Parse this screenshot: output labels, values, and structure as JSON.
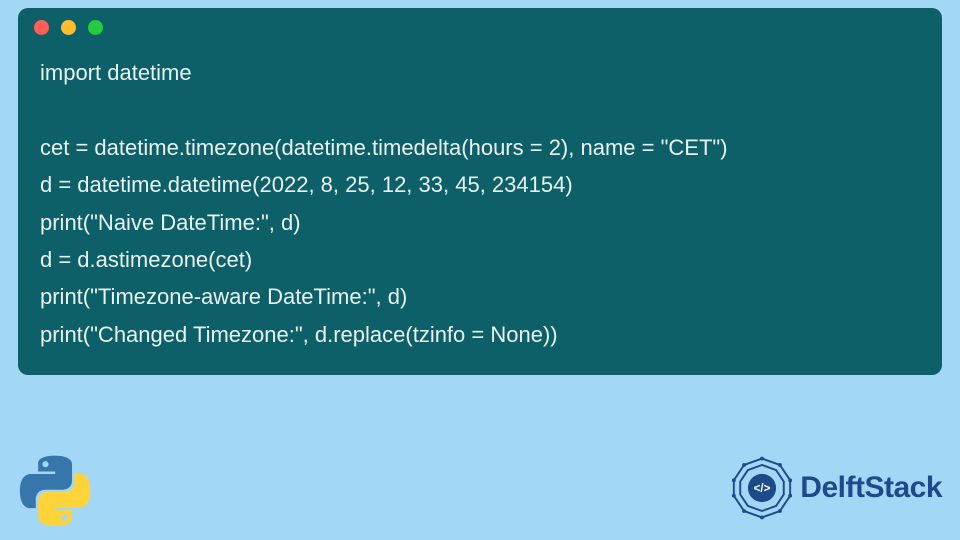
{
  "card": {
    "dots": {
      "red": "#ff5f56",
      "yellow": "#ffbd2e",
      "green": "#27c93f"
    },
    "bg": "#0d6067"
  },
  "code": {
    "lines": [
      "import datetime",
      "",
      "cet = datetime.timezone(datetime.timedelta(hours = 2), name = \"CET\")",
      "d = datetime.datetime(2022, 8, 25, 12, 33, 45, 234154)",
      "print(\"Naive DateTime:\", d)",
      "d = d.astimezone(cet)",
      "print(\"Timezone-aware DateTime:\", d)",
      "print(\"Changed Timezone:\", d.replace(tzinfo = None))"
    ]
  },
  "brand": {
    "name": "DelftStack",
    "color": "#1c4a8a"
  },
  "icons": {
    "python": "python-logo",
    "delft": "delft-logo"
  }
}
